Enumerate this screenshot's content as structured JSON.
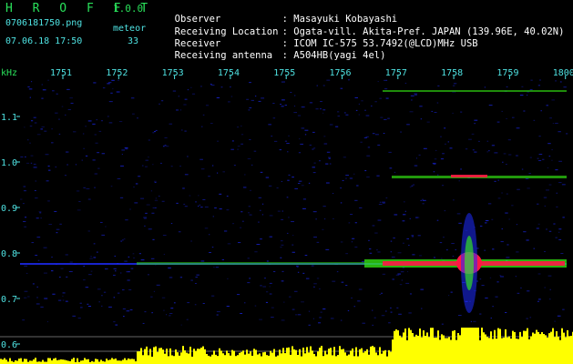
{
  "header": {
    "app_title": "H R O F F T",
    "version": "1.0.0",
    "filename": "0706181750.png",
    "datetime": "07.06.18 17:50",
    "meteor_label": "meteor",
    "meteor_count": "33",
    "info": [
      {
        "key": "Observer",
        "value": ": Masayuki Kobayashi"
      },
      {
        "key": "Receiving Location",
        "value": ": Ogata-vill. Akita-Pref. JAPAN (139.96E, 40.02N)"
      },
      {
        "key": "Receiver",
        "value": ": ICOM IC-575 53.7492(@LCD)MHz USB"
      },
      {
        "key": "Receiving antenna",
        "value": ": A504HB(yagi 4el)"
      }
    ]
  },
  "spectrogram": {
    "y_unit": "kHz",
    "time_ticks": [
      "1751",
      "1752",
      "1753",
      "1754",
      "1755",
      "1756",
      "1757",
      "1758",
      "1759",
      "1800"
    ],
    "freq_ticks": [
      "1.1",
      "1.0",
      "0.9",
      "0.8",
      "0.7",
      "0.6"
    ],
    "colors": {
      "label": "#29e05a",
      "tick_text": "#4fe3e3",
      "signal_red": "#ff1744",
      "signal_yellow": "#ffff00",
      "signal_green": "#39ff14",
      "signal_blue": "#1e2cff"
    }
  }
}
